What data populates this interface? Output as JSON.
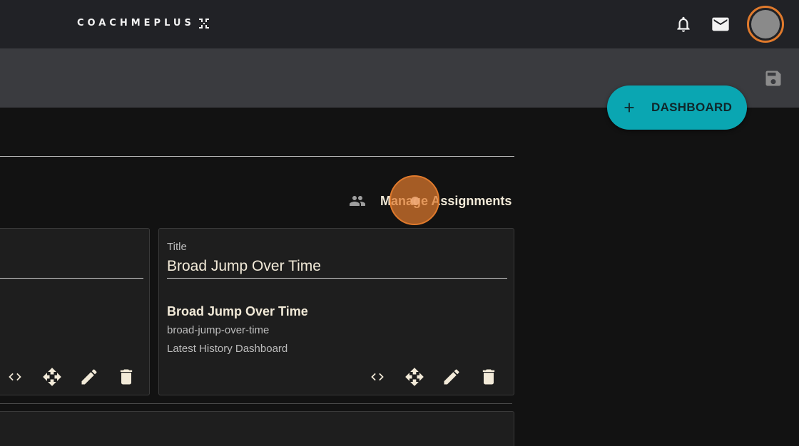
{
  "header": {
    "logo_text": "COACHMEPLUS",
    "icons": [
      "bell-icon",
      "mail-icon"
    ],
    "avatar": "user-avatar",
    "accent_color": "#e07a2c"
  },
  "toolbar": {
    "save_icon": "save-icon"
  },
  "fab": {
    "label": "DASHBOARD",
    "icon": "plus-icon",
    "color": "#0aa6b2"
  },
  "assignments": {
    "label": "Manage Assignments",
    "icon": "people-icon"
  },
  "widgets": [
    {
      "field_label": "Title",
      "field_value": "Broad Jump Over Time",
      "info_title": "Broad Jump Over Time",
      "info_slug": "broad-jump-over-time",
      "info_type": "Latest History Dashboard",
      "actions": [
        "code-icon",
        "move-icon",
        "edit-icon",
        "delete-icon"
      ]
    }
  ]
}
